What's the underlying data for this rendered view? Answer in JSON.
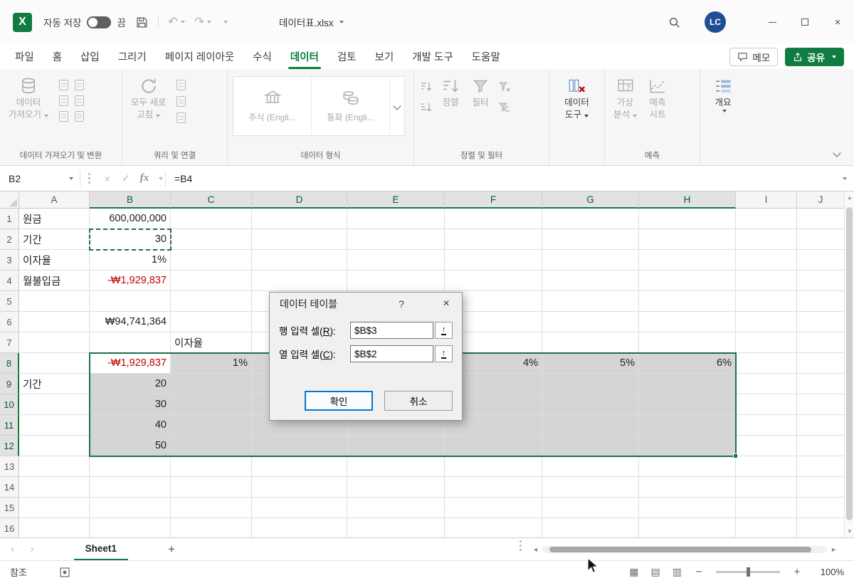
{
  "colors": {
    "accent": "#107c41",
    "selection_border": "#1e7145",
    "negative": "#c00000"
  },
  "titlebar": {
    "autosave_label": "자동 저장",
    "autosave_state": "끔",
    "filename": "데이터표.xlsx",
    "avatar_initials": "LC"
  },
  "ribbon_tabs": {
    "items": [
      {
        "key": "file",
        "label": "파일"
      },
      {
        "key": "home",
        "label": "홈"
      },
      {
        "key": "insert",
        "label": "삽입"
      },
      {
        "key": "draw",
        "label": "그리기"
      },
      {
        "key": "page-layout",
        "label": "페이지 레이아웃"
      },
      {
        "key": "formulas",
        "label": "수식"
      },
      {
        "key": "data",
        "label": "데이터"
      },
      {
        "key": "review",
        "label": "검토"
      },
      {
        "key": "view",
        "label": "보기"
      },
      {
        "key": "developer",
        "label": "개발 도구"
      },
      {
        "key": "help",
        "label": "도움말"
      }
    ],
    "active": "데이터",
    "memo_label": "메모",
    "share_label": "공유"
  },
  "ribbon": {
    "get_data_l1": "데이터",
    "get_data_l2": "가져오기",
    "refresh_l1": "모두 새로",
    "refresh_l2": "고침",
    "stocks_label": "주식 (Engli...",
    "currency_label": "통화 (Engli...",
    "sort_label": "정렬",
    "filter_label": "필터",
    "data_tools_l1": "데이터",
    "data_tools_l2": "도구",
    "whatif_l1": "가상",
    "whatif_l2": "분석",
    "forecast_l1": "예측",
    "forecast_l2": "시트",
    "outline_label": "개요",
    "group_labels": {
      "get_transform": "데이터 가져오기 및 변환",
      "queries": "쿼리 및 연결",
      "data_types": "데이터 형식",
      "sort_filter": "정렬 및 필터",
      "forecast": "예측"
    }
  },
  "formula_bar": {
    "name_box": "B2",
    "fx_label": "fx",
    "formula": "=B4"
  },
  "grid": {
    "col_headers": [
      "A",
      "B",
      "C",
      "D",
      "E",
      "F",
      "G",
      "H",
      "I",
      "J"
    ],
    "row_count": 16,
    "selected_columns": [
      "B",
      "C",
      "D",
      "E",
      "F",
      "G",
      "H"
    ],
    "selected_rows": [
      8,
      9,
      10,
      11,
      12
    ],
    "active_cell": "B8",
    "marching_ants_cell": "B2",
    "cells": [
      {
        "c": "A",
        "r": 1,
        "v": "원금",
        "align": "left"
      },
      {
        "c": "B",
        "r": 1,
        "v": "600,000,000",
        "align": "right"
      },
      {
        "c": "A",
        "r": 2,
        "v": "기간",
        "align": "left"
      },
      {
        "c": "B",
        "r": 2,
        "v": "30",
        "align": "right"
      },
      {
        "c": "A",
        "r": 3,
        "v": "이자율",
        "align": "left"
      },
      {
        "c": "B",
        "r": 3,
        "v": "1%",
        "align": "right"
      },
      {
        "c": "A",
        "r": 4,
        "v": "월불입금",
        "align": "left"
      },
      {
        "c": "B",
        "r": 4,
        "v": "-₩1,929,837",
        "align": "right",
        "color": "#c00000"
      },
      {
        "c": "B",
        "r": 6,
        "v": "₩94,741,364",
        "align": "right"
      },
      {
        "c": "C",
        "r": 7,
        "v": "이자율",
        "align": "left"
      },
      {
        "c": "B",
        "r": 8,
        "v": "-₩1,929,837",
        "align": "right",
        "color": "#c00000"
      },
      {
        "c": "C",
        "r": 8,
        "v": "1%",
        "align": "right"
      },
      {
        "c": "F",
        "r": 8,
        "v": "4%",
        "align": "right"
      },
      {
        "c": "G",
        "r": 8,
        "v": "5%",
        "align": "right"
      },
      {
        "c": "H",
        "r": 8,
        "v": "6%",
        "align": "right"
      },
      {
        "c": "A",
        "r": 9,
        "v": "기간",
        "align": "left"
      },
      {
        "c": "B",
        "r": 9,
        "v": "20",
        "align": "right"
      },
      {
        "c": "B",
        "r": 10,
        "v": "30",
        "align": "right"
      },
      {
        "c": "B",
        "r": 11,
        "v": "40",
        "align": "right"
      },
      {
        "c": "B",
        "r": 12,
        "v": "50",
        "align": "right"
      }
    ]
  },
  "dialog": {
    "title": "데이터 테이블",
    "help_glyph": "?",
    "row_field": {
      "label_pre": "행 입력 셀(",
      "label_key": "R",
      "label_post": "):",
      "value": "$B$3"
    },
    "col_field": {
      "label_pre": "열 입력 셀(",
      "label_key": "C",
      "label_post": "):",
      "value": "$B$2"
    },
    "ok_label": "확인",
    "cancel_label": "취소"
  },
  "sheet_bar": {
    "tabs": [
      {
        "key": "sheet1",
        "label": "Sheet1"
      }
    ],
    "active_tab": "Sheet1"
  },
  "status_bar": {
    "mode": "참조",
    "zoom": "100%"
  }
}
